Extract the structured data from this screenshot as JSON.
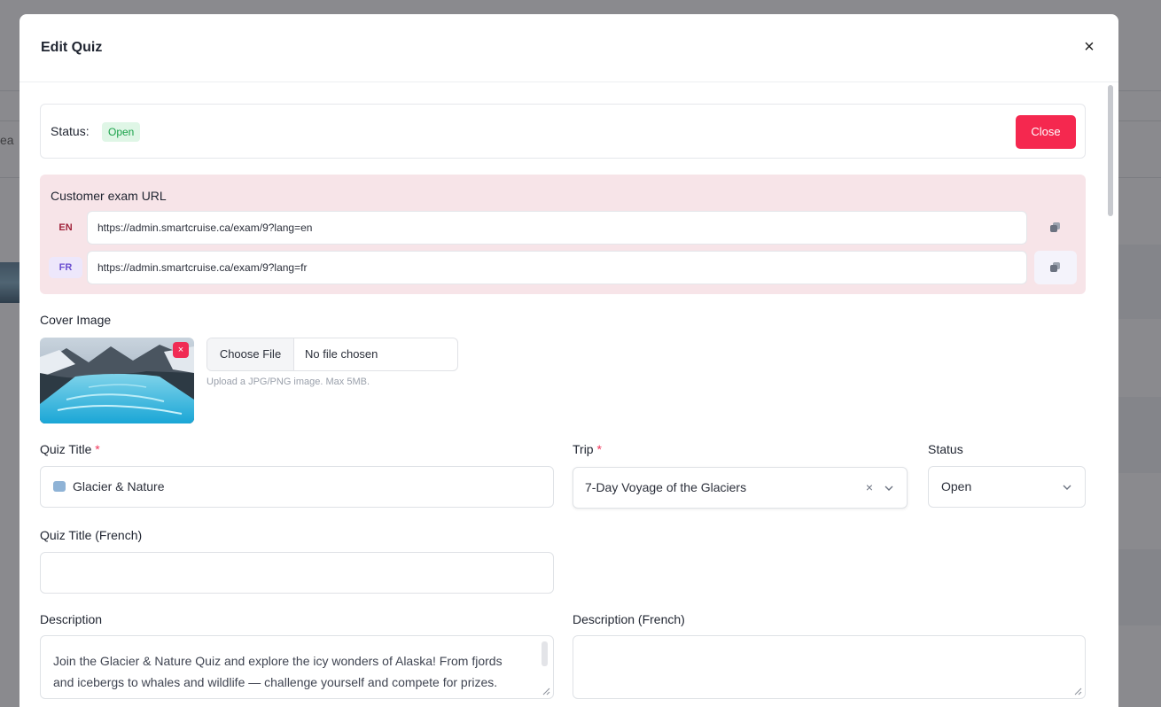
{
  "modal": {
    "title": "Edit Quiz",
    "close_glyph": "×"
  },
  "status_card": {
    "label": "Status:",
    "badge": "Open",
    "close_button": "Close"
  },
  "exam_url": {
    "heading": "Customer exam URL",
    "rows": [
      {
        "lang": "EN",
        "url": "https://admin.smartcruise.ca/exam/9?lang=en",
        "icon": "copy-icon"
      },
      {
        "lang": "FR",
        "url": "https://admin.smartcruise.ca/exam/9?lang=fr",
        "icon": "copy-icon"
      }
    ]
  },
  "cover_image": {
    "label": "Cover Image",
    "remove_glyph": "×",
    "choose_button": "Choose File",
    "file_status": "No file chosen",
    "hint": "Upload a JPG/PNG image. Max 5MB."
  },
  "form": {
    "quiz_title_label": "Quiz Title",
    "required_mark": "*",
    "quiz_title_value": "Glacier & Nature",
    "trip_label": "Trip",
    "trip_value": "7-Day Voyage of the Glaciers",
    "trip_clear_glyph": "×",
    "status_label": "Status",
    "status_value": "Open",
    "quiz_title_fr_label": "Quiz Title (French)",
    "quiz_title_fr_value": "",
    "description_label": "Description",
    "description_value": "Join the Glacier & Nature Quiz and explore the icy wonders of Alaska! From fjords and icebergs to whales and wildlife — challenge yourself and compete for prizes.",
    "description_fr_label": "Description (French)",
    "description_fr_value": ""
  },
  "colors": {
    "danger": "#f5284f",
    "badge_bg": "#dff6e6",
    "badge_text": "#1aa24a",
    "url_card_bg": "#f7e4e8"
  },
  "background": {
    "peek_text": "ea"
  }
}
